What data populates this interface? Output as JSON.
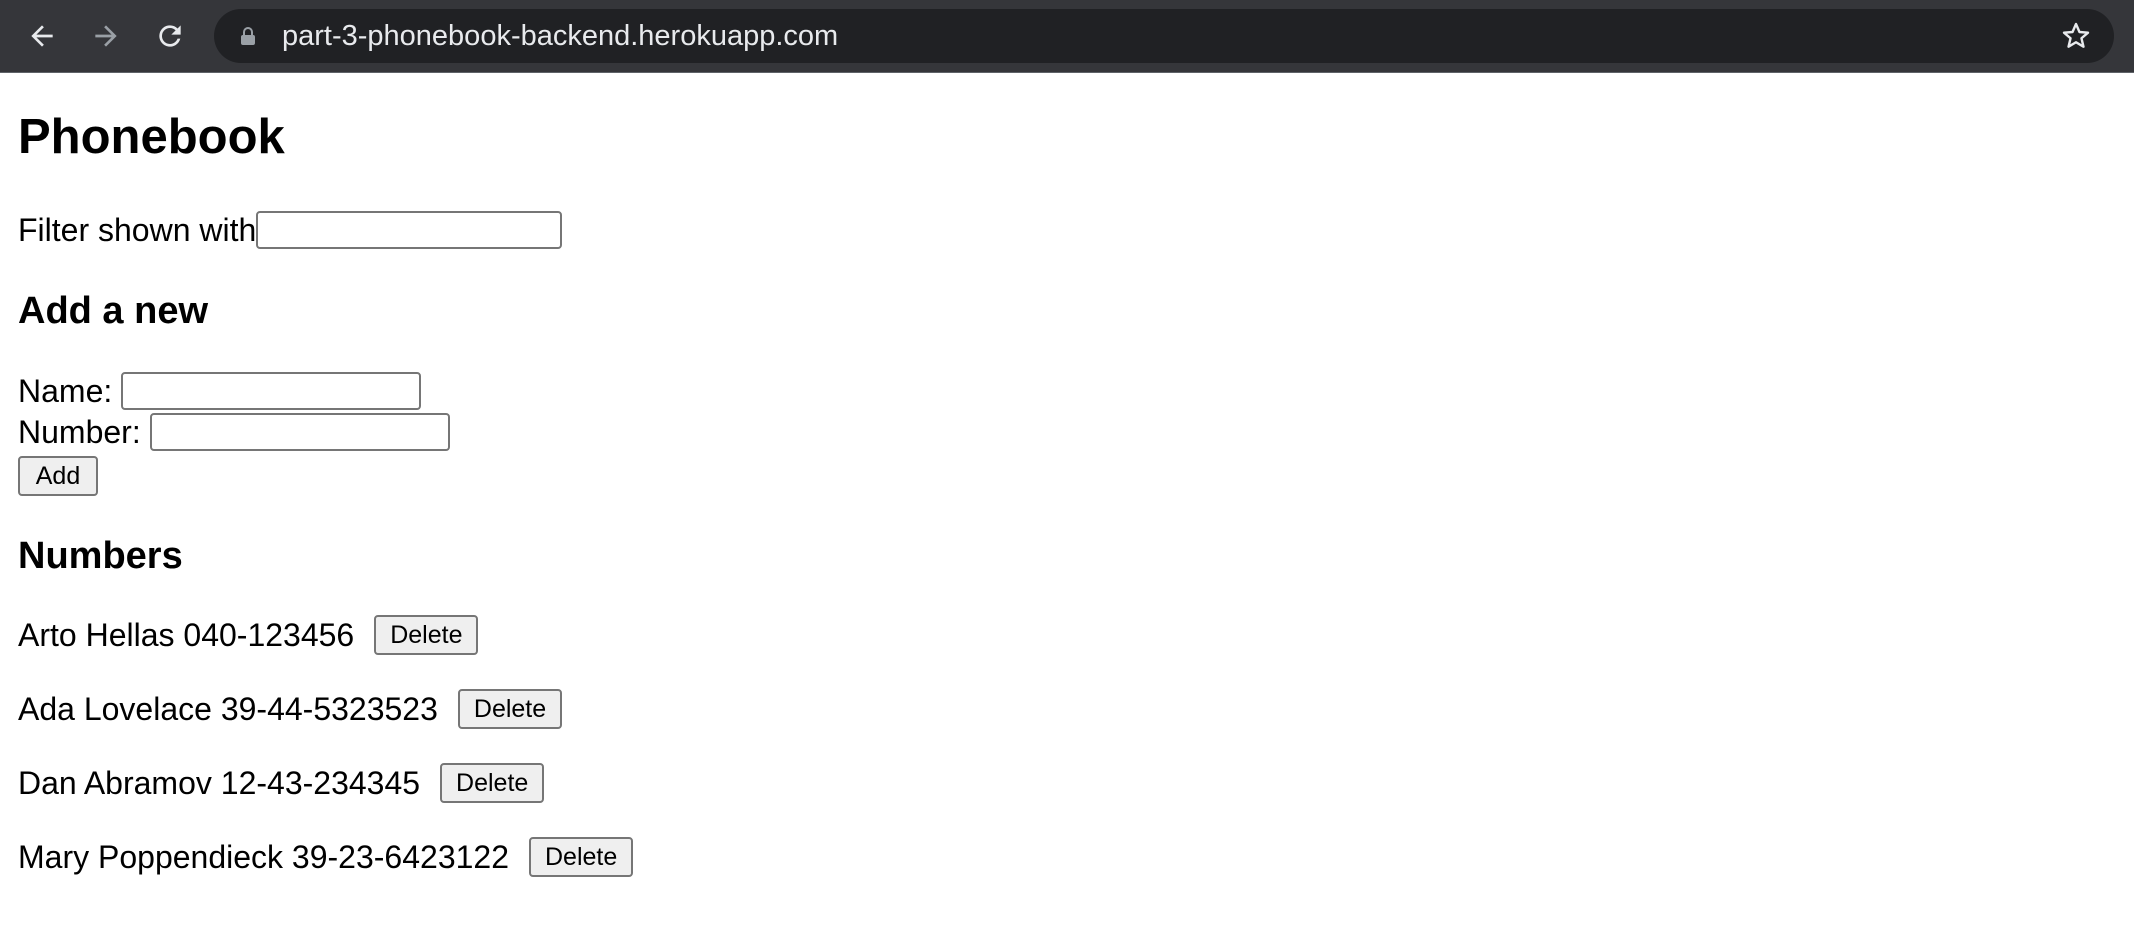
{
  "browser": {
    "url": "part-3-phonebook-backend.herokuapp.com"
  },
  "page": {
    "title": "Phonebook",
    "filter_label": "Filter shown with",
    "filter_value": "",
    "add_heading": "Add a new",
    "name_label": "Name:",
    "name_value": "",
    "number_label": "Number:",
    "number_value": "",
    "add_button": "Add",
    "numbers_heading": "Numbers",
    "persons": [
      {
        "text": "Arto Hellas 040-123456",
        "button": "Delete"
      },
      {
        "text": "Ada Lovelace 39-44-5323523",
        "button": "Delete"
      },
      {
        "text": "Dan Abramov 12-43-234345",
        "button": "Delete"
      },
      {
        "text": "Mary Poppendieck 39-23-6423122",
        "button": "Delete"
      }
    ]
  },
  "colors": {
    "toolbar": "#35363a",
    "omnibox": "#202124",
    "url_text": "#e8eaed",
    "button_bg": "#efefef"
  },
  "icons": [
    "back-arrow-icon",
    "forward-arrow-icon",
    "reload-icon",
    "lock-icon",
    "star-icon"
  ]
}
